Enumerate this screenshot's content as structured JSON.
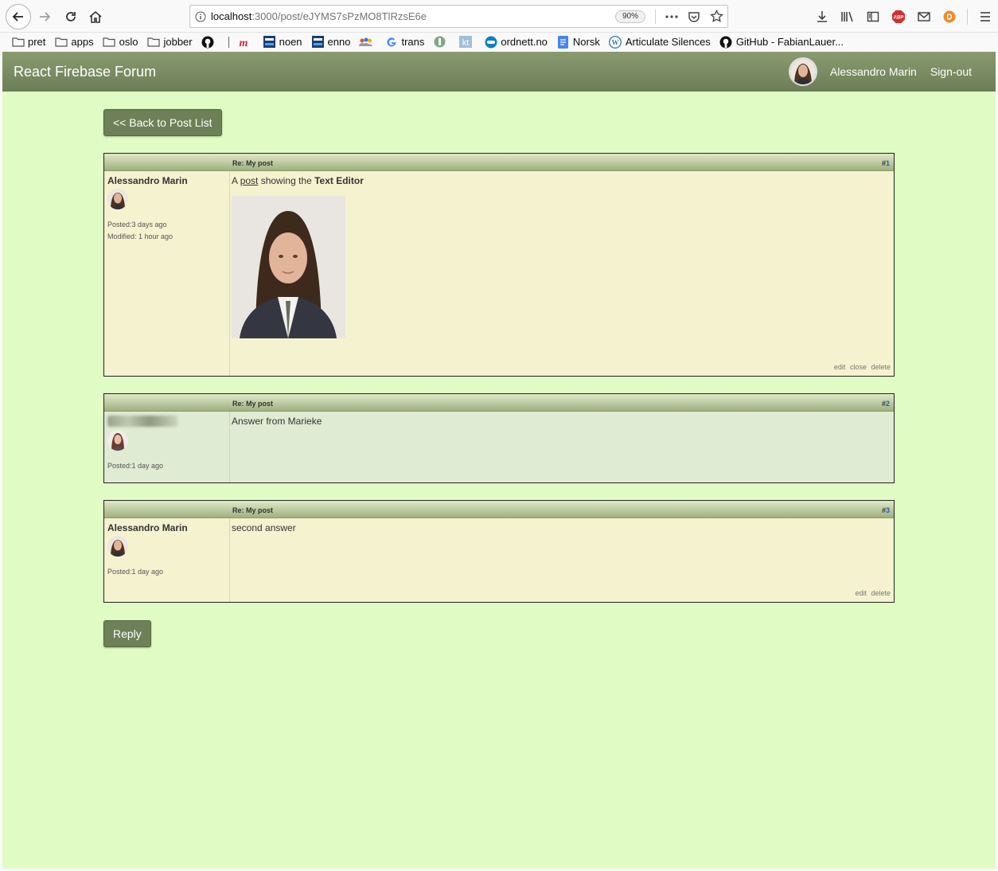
{
  "browser": {
    "url_host": "localhost",
    "url_path": ":3000/post/eJYMS7sPzMO8TlRzsE6e",
    "zoom": "90%",
    "bookmarks": [
      {
        "label": "pret",
        "icon": "folder-icon"
      },
      {
        "label": "apps",
        "icon": "folder-icon"
      },
      {
        "label": "oslo",
        "icon": "folder-icon"
      },
      {
        "label": "jobber",
        "icon": "folder-icon"
      },
      {
        "label": "",
        "icon": "github-icon"
      },
      {
        "label": "",
        "icon": "m-logo-icon"
      },
      {
        "label": "noen",
        "icon": "dictionary-icon"
      },
      {
        "label": "enno",
        "icon": "dictionary-icon"
      },
      {
        "label": "",
        "icon": "people-icon"
      },
      {
        "label": "trans",
        "icon": "google-icon"
      },
      {
        "label": "",
        "icon": "circle-logo-icon"
      },
      {
        "label": "",
        "icon": "kt-icon"
      },
      {
        "label": "ordnett.no",
        "icon": "ordnett-icon"
      },
      {
        "label": "Norsk",
        "icon": "doc-icon"
      },
      {
        "label": "Articulate Silences",
        "icon": "wordpress-icon"
      },
      {
        "label": "GitHub - FabianLauer...",
        "icon": "github-icon"
      }
    ]
  },
  "app": {
    "title": "React Firebase Forum",
    "user_name": "Alessandro Marin",
    "signout": "Sign-out",
    "back_label": "<< Back to Post List",
    "reply_label": "Reply"
  },
  "posts": [
    {
      "subject": "Re: My post",
      "hash": "#",
      "num": "1",
      "author": "Alessandro Marin",
      "posted": "Posted:3 days ago",
      "modified": "Modified: 1 hour ago",
      "content_a": "A ",
      "content_link": "post",
      "content_b": " showing the ",
      "content_bold": "Text Editor",
      "actions": [
        "edit",
        "close",
        "delete"
      ]
    },
    {
      "subject": "Re: My post",
      "hash": "#",
      "num": "2",
      "posted": "Posted:1 day ago",
      "content": "Answer from Marieke"
    },
    {
      "subject": "Re: My post",
      "hash": "#",
      "num": "3",
      "author": "Alessandro Marin",
      "posted": "Posted:1 day ago",
      "content": "second answer",
      "actions": [
        "edit",
        "delete"
      ]
    }
  ]
}
